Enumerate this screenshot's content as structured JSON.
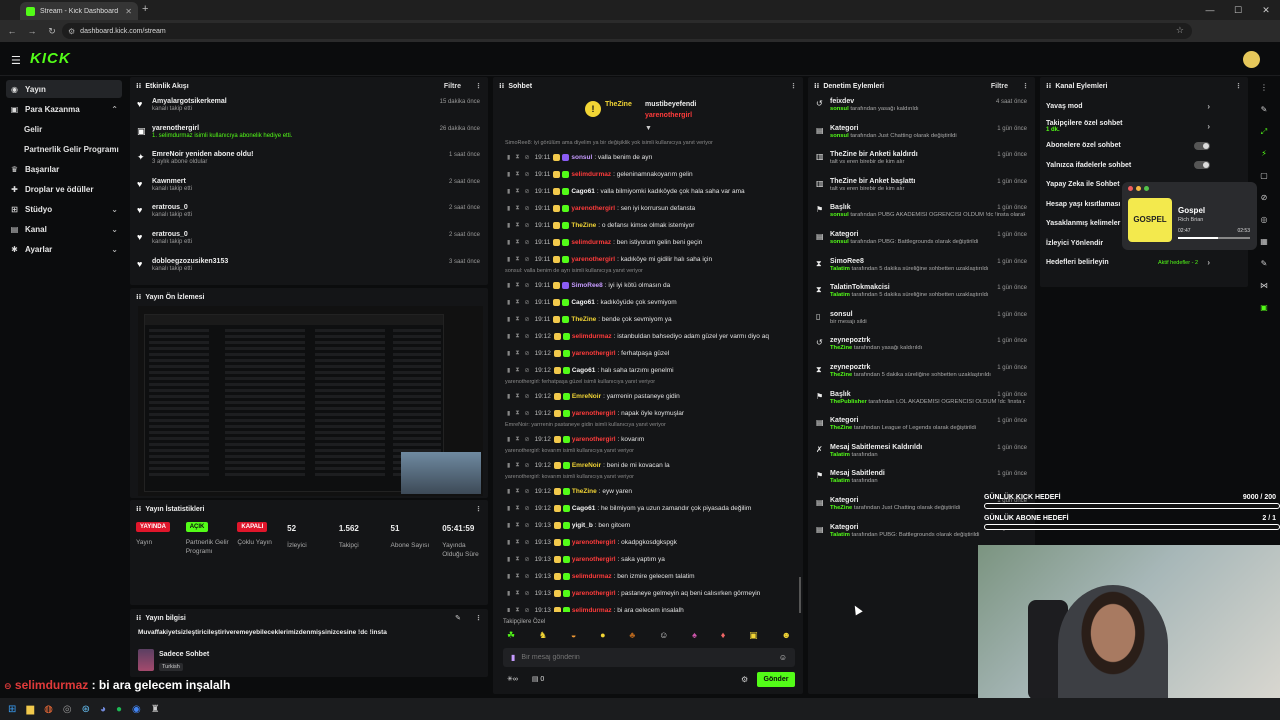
{
  "browser": {
    "tab_title": "Stream - Kick Dashboard",
    "url": "dashboard.kick.com/stream"
  },
  "app": {
    "logo": "KICK"
  },
  "sidebar": {
    "items": [
      {
        "label": "Yayın",
        "icon": "broadcast-icon"
      },
      {
        "label": "Para Kazanma",
        "icon": "money-icon"
      },
      {
        "label": "Başarılar",
        "icon": "trophy-icon"
      },
      {
        "label": "Droplar ve ödüller",
        "icon": "gift-icon"
      },
      {
        "label": "Stüdyo",
        "icon": "studio-icon"
      },
      {
        "label": "Kanal",
        "icon": "channel-icon"
      },
      {
        "label": "Ayarlar",
        "icon": "gear-icon"
      }
    ],
    "sub_items": [
      "Gelir",
      "Partnerlik Gelir Programı"
    ]
  },
  "activity": {
    "title": "Etkinlik Akışı",
    "filter": "Filtre",
    "rows": [
      {
        "name": "Amyalargotsikerkemal",
        "sub": "kanalı takip etti",
        "time": "15 dakika önce",
        "icon": "heart-icon",
        "sub_green": false
      },
      {
        "name": "yarenothergirl",
        "sub": "1. selimdurmaz isimli kullanıcıya abonelik hediye etti.",
        "time": "26 dakika önce",
        "icon": "gift-icon",
        "sub_green": true
      },
      {
        "name": "EmreNoir yeniden abone oldu!",
        "sub": "3 aylık abone oldular",
        "time": "1 saat önce",
        "icon": "star-icon",
        "sub_green": false
      },
      {
        "name": "Kawnmert",
        "sub": "kanalı takip etti",
        "time": "2 saat önce",
        "icon": "heart-icon",
        "sub_green": false
      },
      {
        "name": "eratrous_0",
        "sub": "kanalı takip etti",
        "time": "2 saat önce",
        "icon": "heart-icon",
        "sub_green": false
      },
      {
        "name": "eratrous_0",
        "sub": "kanalı takip etti",
        "time": "2 saat önce",
        "icon": "heart-icon",
        "sub_green": false
      },
      {
        "name": "dobloegzozusiken3153",
        "sub": "kanalı takip etti",
        "time": "3 saat önce",
        "icon": "heart-icon",
        "sub_green": false
      }
    ]
  },
  "preview": {
    "title": "Yayın Ön İzlemesi"
  },
  "stream_stats": {
    "title": "Yayın İstatistikleri",
    "items": [
      {
        "badge": "YAYINDA",
        "badge_color": "#e0162b",
        "label": "Yayın"
      },
      {
        "badge": "AÇIK",
        "badge_color": "#53fc18",
        "label": "Partnerlik Gelir Programı"
      },
      {
        "badge": "KAPALI",
        "badge_color": "#e0162b",
        "label": "Çoklu Yayın"
      },
      {
        "value": "52",
        "label": "İzleyici"
      },
      {
        "value": "1.562",
        "label": "Takipçi"
      },
      {
        "value": "51",
        "label": "Abone Sayısı"
      },
      {
        "value": "05:41:59",
        "label": "Yayında Olduğu Süre"
      }
    ]
  },
  "stream_info": {
    "title": "Yayın bilgisi",
    "stream_title": "Muvaffakiyetsizleştiricileştiriveremeyebileceklerimizdenmişsinizcesine !dc !insta",
    "category": "Sadece Sohbet",
    "language": "Turkish"
  },
  "chat": {
    "title": "Sohbet",
    "pinned": [
      {
        "user": "TheZine",
        "label": "mustibeyefendi"
      },
      {
        "user": "yarenothergirl"
      }
    ],
    "lines": [
      {
        "type": "reply",
        "text": "SimoRee8: iyi görülüm ama diyelim ya bir değişiklik yok isimli kullanıcıya yanıt veriyor"
      },
      {
        "time": "19:11",
        "user": "sonsul",
        "color": "#c69bff",
        "text": ": valla benim de ayrı"
      },
      {
        "time": "19:11",
        "user": "selimdurmaz",
        "color": "#ff3b3b",
        "text": ": geleninamnakoyarım gelin"
      },
      {
        "time": "19:11",
        "user": "Cago61",
        "color": "#f5f5f5",
        "text": ": valla bilmiyomki kadıköyde çok hala saha var ama"
      },
      {
        "time": "19:11",
        "user": "yarenothergirl",
        "color": "#ff3b3b",
        "text": ": sen iyi korrursun defansta"
      },
      {
        "time": "19:11",
        "user": "TheZine",
        "color": "#f2d535",
        "text": ": o defansı kimse olmak istemiyor"
      },
      {
        "time": "19:11",
        "user": "selimdurmaz",
        "color": "#ff3b3b",
        "text": ": ben istiyorum gelin beni geçin"
      },
      {
        "time": "19:11",
        "user": "yarenothergirl",
        "color": "#ff3b3b",
        "text": ": kadıköye mi gidilir halı saha için"
      },
      {
        "type": "reply",
        "text": "sonsul: valla benim de ayrı isimli kullanıcıya yanıt veriyor"
      },
      {
        "time": "19:11",
        "user": "SimoRee8",
        "color": "#c69bff",
        "text": ": iyi iyi kötü olmasın da"
      },
      {
        "time": "19:11",
        "user": "Cago61",
        "color": "#f5f5f5",
        "text": ": kadıköyüde çok sevmiyom"
      },
      {
        "time": "19:11",
        "user": "TheZine",
        "color": "#f2d535",
        "text": ": bende çok sevmiyom ya"
      },
      {
        "time": "19:12",
        "user": "selimdurmaz",
        "color": "#ff3b3b",
        "text": ": istanbuldan bahsediyo adam güzel yer varmı diyo aq"
      },
      {
        "time": "19:12",
        "user": "yarenothergirl",
        "color": "#ff3b3b",
        "text": ": ferhatpaşa güzel"
      },
      {
        "time": "19:12",
        "user": "Cago61",
        "color": "#f5f5f5",
        "text": ": halı saha tarzımı genelmi"
      },
      {
        "type": "reply",
        "text": "yarenothergirl: ferhatpaşa güzel isimli kullanıcıya yanıt veriyor"
      },
      {
        "time": "19:12",
        "user": "EmreNoir",
        "color": "#f2d535",
        "text": ": yarrrenin pastaneye gidin"
      },
      {
        "time": "19:12",
        "user": "yarenothergirl",
        "color": "#ff3b3b",
        "text": ": napak öyle koymuşlar"
      },
      {
        "type": "reply",
        "text": "EmreNoir: yarrrenin pastaneye gidin isimli kullanıcıya yanıt veriyor"
      },
      {
        "time": "19:12",
        "user": "yarenothergirl",
        "color": "#ff3b3b",
        "text": ": kovarım"
      },
      {
        "type": "reply",
        "text": "yarenothergirl: kovarım isimli kullanıcıya yanıt veriyor"
      },
      {
        "time": "19:12",
        "user": "EmreNoir",
        "color": "#f2d535",
        "text": ": beni de mi kovacan la"
      },
      {
        "type": "reply",
        "text": "yarenothergirl: kovarım isimli kullanıcıya yanıt veriyor"
      },
      {
        "time": "19:12",
        "user": "TheZine",
        "color": "#f2d535",
        "text": ": eyw yaren"
      },
      {
        "time": "19:12",
        "user": "Cago61",
        "color": "#f5f5f5",
        "text": ": he bilmiyom ya uzun zamandır çok piyasada değilim"
      },
      {
        "time": "19:13",
        "user": "yigit_b",
        "color": "#f5f5f5",
        "text": ": ben gitcem"
      },
      {
        "time": "19:13",
        "user": "yarenothergirl",
        "color": "#ff3b3b",
        "text": ": okadpgkosdgkspgk"
      },
      {
        "time": "19:13",
        "user": "yarenothergirl",
        "color": "#ff3b3b",
        "text": ": saka yaptım ya"
      },
      {
        "time": "19:13",
        "user": "selimdurmaz",
        "color": "#ff3b3b",
        "text": ": ben izmire gelecem talatim"
      },
      {
        "time": "19:13",
        "user": "yarenothergirl",
        "color": "#ff3b3b",
        "text": ": pastaneye gelmeyin aq beni calısırken görmeyin"
      },
      {
        "time": "19:13",
        "user": "selimdurmaz",
        "color": "#ff3b3b",
        "text": ": bi ara gelecem inşalalh"
      }
    ],
    "followers_only": "Takipçilere Özel",
    "input_placeholder": "Bir mesaj gönderin",
    "send": "Gönder",
    "viewer_count": "0"
  },
  "moderation": {
    "title": "Denetim Eylemleri",
    "filter": "Filtre",
    "rows": [
      {
        "name": "feixdev",
        "actor": "sonsul",
        "rest": "tarafından yasağı kaldırıldı",
        "time": "4 saat önce",
        "icon": "undo-icon"
      },
      {
        "name": "Kategori",
        "actor": "sonsul",
        "rest": "tarafından Just Chatting olarak değiştirildi",
        "time": "1 gün önce",
        "icon": "category-icon"
      },
      {
        "name": "TheZine bir Anketi kaldırdı",
        "actor": "",
        "rest": "talt vs eren birebir de kim alır",
        "time": "1 gün önce",
        "icon": "poll-icon"
      },
      {
        "name": "TheZine bir Anket başlattı",
        "actor": "",
        "rest": "talt vs eren birebir de kim alır",
        "time": "1 gün önce",
        "icon": "poll-icon"
      },
      {
        "name": "Başlık",
        "actor": "sonsul",
        "rest": "tarafından PUBG AKADEMİSİ ÖĞRENCİSİ OLDUM !dc !insta olarak değiştirildi",
        "time": "1 gün önce",
        "icon": "pin-icon"
      },
      {
        "name": "Kategori",
        "actor": "sonsul",
        "rest": "tarafından PUBG: Battlegrounds olarak değiştirildi",
        "time": "1 gün önce",
        "icon": "category-icon"
      },
      {
        "name": "SimoRee8",
        "actor": "Talatim",
        "rest": "tarafından 5 dakika süreliğine sohbetten uzaklaştırıldı",
        "time": "1 gün önce",
        "icon": "hourglass-icon"
      },
      {
        "name": "TalatinTokmakcisi",
        "actor": "Talatim",
        "rest": "tarafından 5 dakika süreliğine sohbetten uzaklaştırıldı",
        "time": "1 gün önce",
        "icon": "hourglass-icon"
      },
      {
        "name": "sonsul",
        "actor": "",
        "rest": "bir mesajı sildi",
        "time": "1 gün önce",
        "icon": "trash-icon"
      },
      {
        "name": "zeynepoztrk",
        "actor": "TheZine",
        "rest": "tarafından yasağı kaldırıldı",
        "time": "1 gün önce",
        "icon": "undo-icon"
      },
      {
        "name": "zeynepoztrk",
        "actor": "TheZine",
        "rest": "tarafından 5 dakika süreliğine sohbetten uzaklaştırıldı",
        "time": "1 gün önce",
        "icon": "hourglass-icon"
      },
      {
        "name": "Başlık",
        "actor": "ThePublisher",
        "rest": "tarafından LOL AKADEMİSİ ÖĞRENCİSİ OLDUM !dc !insta olarak değiştirildi",
        "time": "1 gün önce",
        "icon": "pin-icon"
      },
      {
        "name": "Kategori",
        "actor": "TheZine",
        "rest": "tarafından League of Legends olarak değiştirildi",
        "time": "1 gün önce",
        "icon": "category-icon"
      },
      {
        "name": "Mesaj Sabitlemesi Kaldırıldı",
        "actor": "Talatim",
        "rest": "tarafından",
        "time": "1 gün önce",
        "icon": "unpin-icon"
      },
      {
        "name": "Mesaj Sabitlendi",
        "actor": "Talatim",
        "rest": "tarafından",
        "time": "1 gün önce",
        "icon": "pin-icon"
      },
      {
        "name": "Kategori",
        "actor": "TheZine",
        "rest": "tarafından Just Chatting olarak değiştirildi",
        "time": "1 gün önce",
        "icon": "category-icon"
      },
      {
        "name": "Kategori",
        "actor": "Talatim",
        "rest": "tarafından PUBG: Battlegrounds olarak değiştirildi",
        "time": "1 gün önce",
        "icon": "category-icon"
      }
    ]
  },
  "channel_actions": {
    "title": "Kanal Eylemleri",
    "rows": [
      {
        "label": "Yavaş mod",
        "control": "chevron"
      },
      {
        "label": "Takipçilere özel sohbet",
        "sub": "1 dk.",
        "control": "chevron"
      },
      {
        "label": "Abonelere özel sohbet",
        "control": "toggle"
      },
      {
        "label": "Yalnızca ifadelerle sohbet",
        "control": "toggle"
      },
      {
        "label": "Yapay Zeka ile Sohbet",
        "control": ""
      },
      {
        "label": "Hesap yaşı kısıtlaması",
        "control": ""
      },
      {
        "label": "Yasaklanmış kelimeler",
        "control": ""
      },
      {
        "label": "İzleyici Yönlendir",
        "control": ""
      },
      {
        "label": "Hedefleri belirleyin",
        "control": "chevron",
        "extra": "Aktif hedefler - 2"
      }
    ]
  },
  "music_widget": {
    "cover": "GOSPEL",
    "title": "Gospel",
    "artist": "Rich Brian",
    "elapsed": "02:47",
    "total": "02:53",
    "progress": 0.56
  },
  "goals": [
    {
      "label": "GÜNLÜK KICK HEDEFİ",
      "value": "9000 / 200"
    },
    {
      "label": "GÜNLÜK ABONE HEDEFİ",
      "value": "2 / 1"
    }
  ],
  "overlay": {
    "user": "selimdurmaz",
    "message": ": bi ara gelecem inşalalh"
  }
}
